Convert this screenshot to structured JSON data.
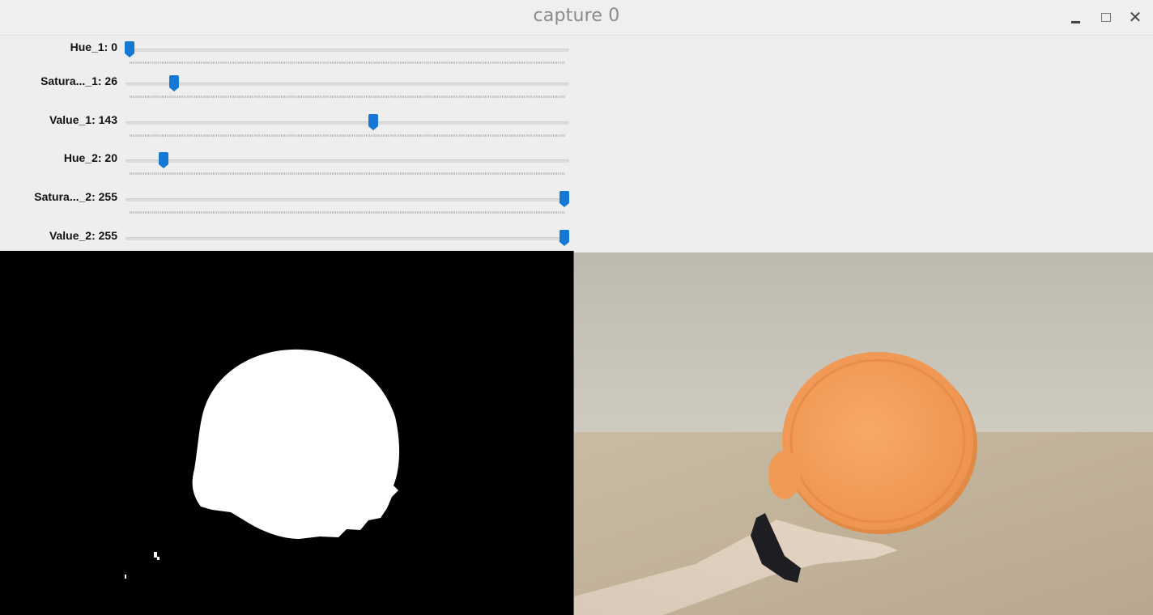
{
  "window": {
    "title": "capture 0",
    "controls": {
      "minimize": "minimize",
      "maximize": "maximize",
      "close": "✕"
    }
  },
  "trackbars": [
    {
      "label": "Hue_1: 0",
      "value": 0,
      "max": 255
    },
    {
      "label": "Satura..._1: 26",
      "value": 26,
      "max": 255
    },
    {
      "label": "Value_1: 143",
      "value": 143,
      "max": 255
    },
    {
      "label": "Hue_2: 20",
      "value": 20,
      "max": 255
    },
    {
      "label": "Satura..._2: 255",
      "value": 255,
      "max": 255
    },
    {
      "label": "Value_2: 255",
      "value": 255,
      "max": 255
    }
  ],
  "colors": {
    "handle": "#1478d4",
    "mask_fg": "#ffffff",
    "mask_bg": "#000000",
    "lid": "#f4a05c"
  },
  "images": {
    "mask": "binary-mask-image",
    "camera": "camera-feed-image"
  }
}
